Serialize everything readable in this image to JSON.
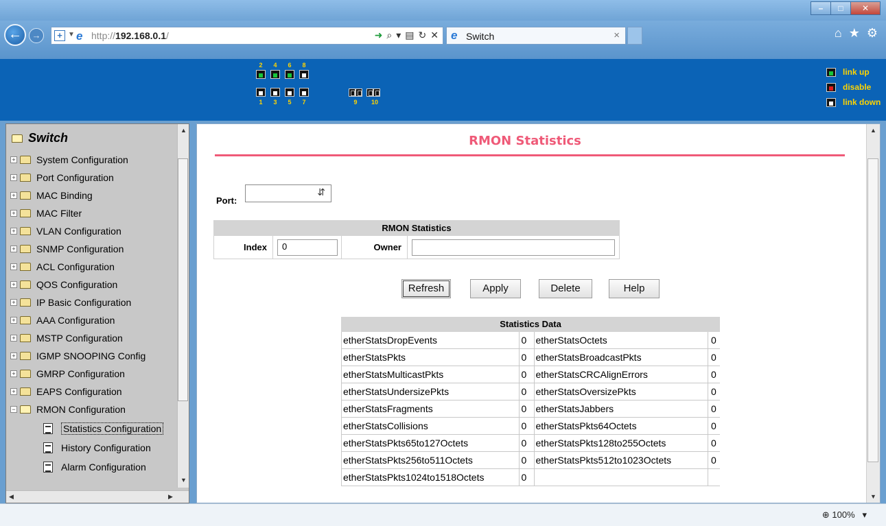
{
  "browser": {
    "url_host": "192.168.0.1",
    "url_prefix": "http://",
    "url_suffix": "/",
    "tab_title": "Switch",
    "zoom": "100%"
  },
  "header": {
    "top_port_numbers": [
      "2",
      "4",
      "6",
      "8"
    ],
    "bottom_port_numbers": [
      "1",
      "3",
      "5",
      "7"
    ],
    "fiber_port_numbers": [
      "9",
      "10"
    ],
    "legend": {
      "up": "link up",
      "disable": "disable",
      "down": "link down"
    },
    "colors": {
      "up": "#18c63a",
      "disable": "#e21b1b",
      "down": "#ffffff",
      "label": "#ffd400"
    }
  },
  "sidebar": {
    "title": "Switch",
    "items": [
      "System Configuration",
      "Port Configuration",
      "MAC Binding",
      "MAC Filter",
      "VLAN Configuration",
      "SNMP Configuration",
      "ACL Configuration",
      "QOS Configuration",
      "IP Basic Configuration",
      "AAA Configuration",
      "MSTP Configuration",
      "IGMP SNOOPING Config",
      "GMRP Configuration",
      "EAPS Configuration",
      "RMON Configuration"
    ],
    "sub_items": [
      "Statistics Configuration",
      "History Configuration",
      "Alarm Configuration"
    ]
  },
  "main": {
    "title": "RMON Statistics",
    "title_color": "#ef5a78",
    "port_label": "Port:",
    "port_value": "",
    "form": {
      "heading": "RMON Statistics",
      "index_label": "Index",
      "index_value": "0",
      "owner_label": "Owner",
      "owner_value": ""
    },
    "buttons": {
      "refresh": "Refresh",
      "apply": "Apply",
      "delete": "Delete",
      "help": "Help"
    },
    "stats": {
      "heading": "Statistics Data",
      "rows": [
        {
          "n1": "etherStatsDropEvents",
          "v1": "0",
          "n2": "etherStatsOctets",
          "v2": "0"
        },
        {
          "n1": "etherStatsPkts",
          "v1": "0",
          "n2": "etherStatsBroadcastPkts",
          "v2": "0"
        },
        {
          "n1": "etherStatsMulticastPkts",
          "v1": "0",
          "n2": "etherStatsCRCAlignErrors",
          "v2": "0"
        },
        {
          "n1": "etherStatsUndersizePkts",
          "v1": "0",
          "n2": "etherStatsOversizePkts",
          "v2": "0"
        },
        {
          "n1": "etherStatsFragments",
          "v1": "0",
          "n2": "etherStatsJabbers",
          "v2": "0"
        },
        {
          "n1": "etherStatsCollisions",
          "v1": "0",
          "n2": "etherStatsPkts64Octets",
          "v2": "0"
        },
        {
          "n1": "etherStatsPkts65to127Octets",
          "v1": "0",
          "n2": "etherStatsPkts128to255Octets",
          "v2": "0"
        },
        {
          "n1": "etherStatsPkts256to511Octets",
          "v1": "0",
          "n2": "etherStatsPkts512to1023Octets",
          "v2": "0"
        },
        {
          "n1": "etherStatsPkts1024to1518Octets",
          "v1": "0",
          "n2": "",
          "v2": ""
        }
      ]
    }
  }
}
